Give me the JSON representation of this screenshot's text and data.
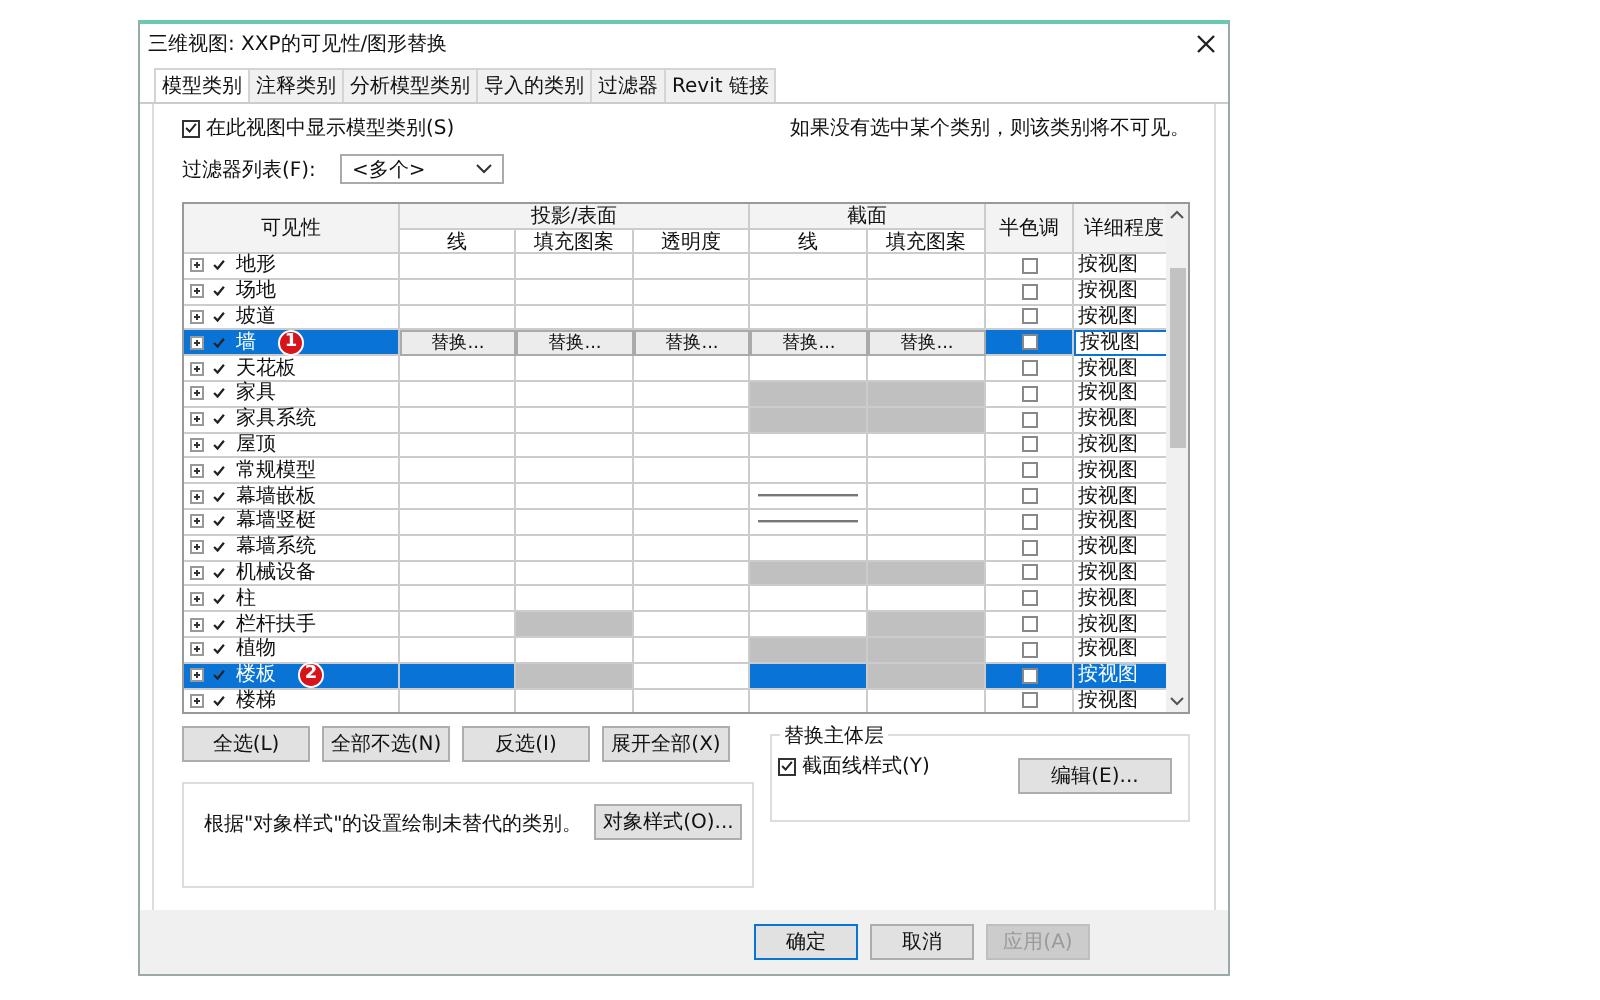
{
  "window": {
    "title": "三维视图: XXP的可见性/图形替换"
  },
  "tabs": [
    {
      "label": "模型类别",
      "selected": true
    },
    {
      "label": "注释类别",
      "selected": false
    },
    {
      "label": "分析模型类别",
      "selected": false
    },
    {
      "label": "导入的类别",
      "selected": false
    },
    {
      "label": "过滤器",
      "selected": false
    },
    {
      "label": "Revit 链接",
      "selected": false
    }
  ],
  "show_categories": {
    "label": "在此视图中显示模型类别(S)",
    "checked": true
  },
  "hint": "如果没有选中某个类别，则该类别将不可见。",
  "filter_list": {
    "label": "过滤器列表(F):",
    "value": "<多个>"
  },
  "table": {
    "group_headers": [
      {
        "label": "可见性"
      },
      {
        "label": "投影/表面"
      },
      {
        "label": "截面"
      },
      {
        "label": "半色调"
      },
      {
        "label": "详细程度"
      }
    ],
    "sub_headers": [
      "线",
      "填充图案",
      "透明度",
      "线",
      "填充图案"
    ],
    "rows": [
      {
        "name": "地形",
        "visible": true,
        "selected": false,
        "cells": [
          {
            "kind": "blank"
          },
          {
            "kind": "blank"
          },
          {
            "kind": "blank"
          },
          {
            "kind": "blank"
          },
          {
            "kind": "blank"
          }
        ],
        "halftone": false,
        "detail": "按视图"
      },
      {
        "name": "场地",
        "visible": true,
        "selected": false,
        "cells": [
          {
            "kind": "blank"
          },
          {
            "kind": "blank"
          },
          {
            "kind": "blank"
          },
          {
            "kind": "blank"
          },
          {
            "kind": "blank"
          }
        ],
        "halftone": false,
        "detail": "按视图"
      },
      {
        "name": "坡道",
        "visible": true,
        "selected": false,
        "cells": [
          {
            "kind": "blank"
          },
          {
            "kind": "blank"
          },
          {
            "kind": "blank"
          },
          {
            "kind": "blank"
          },
          {
            "kind": "blank"
          }
        ],
        "halftone": false,
        "detail": "按视图"
      },
      {
        "name": "墙",
        "visible": true,
        "selected": true,
        "badge": "1",
        "cells": [
          {
            "kind": "override",
            "label": "替换..."
          },
          {
            "kind": "override",
            "label": "替换..."
          },
          {
            "kind": "override",
            "label": "替换..."
          },
          {
            "kind": "override",
            "label": "替换..."
          },
          {
            "kind": "override",
            "label": "替换..."
          }
        ],
        "halftone": false,
        "detail": "按视图",
        "detail_editing": true
      },
      {
        "name": "天花板",
        "visible": true,
        "selected": false,
        "cells": [
          {
            "kind": "blank"
          },
          {
            "kind": "blank"
          },
          {
            "kind": "blank"
          },
          {
            "kind": "blank"
          },
          {
            "kind": "blank"
          }
        ],
        "halftone": false,
        "detail": "按视图"
      },
      {
        "name": "家具",
        "visible": true,
        "selected": false,
        "cells": [
          {
            "kind": "blank"
          },
          {
            "kind": "blank"
          },
          {
            "kind": "blank"
          },
          {
            "kind": "gray"
          },
          {
            "kind": "gray"
          }
        ],
        "halftone": false,
        "detail": "按视图"
      },
      {
        "name": "家具系统",
        "visible": true,
        "selected": false,
        "cells": [
          {
            "kind": "blank"
          },
          {
            "kind": "blank"
          },
          {
            "kind": "blank"
          },
          {
            "kind": "gray"
          },
          {
            "kind": "gray"
          }
        ],
        "halftone": false,
        "detail": "按视图"
      },
      {
        "name": "屋顶",
        "visible": true,
        "selected": false,
        "cells": [
          {
            "kind": "blank"
          },
          {
            "kind": "blank"
          },
          {
            "kind": "blank"
          },
          {
            "kind": "blank"
          },
          {
            "kind": "blank"
          }
        ],
        "halftone": false,
        "detail": "按视图"
      },
      {
        "name": "常规模型",
        "visible": true,
        "selected": false,
        "cells": [
          {
            "kind": "blank"
          },
          {
            "kind": "blank"
          },
          {
            "kind": "blank"
          },
          {
            "kind": "blank"
          },
          {
            "kind": "blank"
          }
        ],
        "halftone": false,
        "detail": "按视图"
      },
      {
        "name": "幕墙嵌板",
        "visible": true,
        "selected": false,
        "cells": [
          {
            "kind": "blank"
          },
          {
            "kind": "blank"
          },
          {
            "kind": "blank"
          },
          {
            "kind": "line"
          },
          {
            "kind": "blank"
          }
        ],
        "halftone": false,
        "detail": "按视图"
      },
      {
        "name": "幕墙竖梃",
        "visible": true,
        "selected": false,
        "cells": [
          {
            "kind": "blank"
          },
          {
            "kind": "blank"
          },
          {
            "kind": "blank"
          },
          {
            "kind": "line"
          },
          {
            "kind": "blank"
          }
        ],
        "halftone": false,
        "detail": "按视图"
      },
      {
        "name": "幕墙系统",
        "visible": true,
        "selected": false,
        "cells": [
          {
            "kind": "blank"
          },
          {
            "kind": "blank"
          },
          {
            "kind": "blank"
          },
          {
            "kind": "blank"
          },
          {
            "kind": "blank"
          }
        ],
        "halftone": false,
        "detail": "按视图"
      },
      {
        "name": "机械设备",
        "visible": true,
        "selected": false,
        "cells": [
          {
            "kind": "blank"
          },
          {
            "kind": "blank"
          },
          {
            "kind": "blank"
          },
          {
            "kind": "gray"
          },
          {
            "kind": "gray"
          }
        ],
        "halftone": false,
        "detail": "按视图"
      },
      {
        "name": "柱",
        "visible": true,
        "selected": false,
        "cells": [
          {
            "kind": "blank"
          },
          {
            "kind": "blank"
          },
          {
            "kind": "blank"
          },
          {
            "kind": "blank"
          },
          {
            "kind": "blank"
          }
        ],
        "halftone": false,
        "detail": "按视图"
      },
      {
        "name": "栏杆扶手",
        "visible": true,
        "selected": false,
        "cells": [
          {
            "kind": "blank"
          },
          {
            "kind": "gray"
          },
          {
            "kind": "blank"
          },
          {
            "kind": "blank"
          },
          {
            "kind": "gray"
          }
        ],
        "halftone": false,
        "detail": "按视图"
      },
      {
        "name": "植物",
        "visible": true,
        "selected": false,
        "cells": [
          {
            "kind": "blank"
          },
          {
            "kind": "blank"
          },
          {
            "kind": "blank"
          },
          {
            "kind": "gray"
          },
          {
            "kind": "gray"
          }
        ],
        "halftone": false,
        "detail": "按视图"
      },
      {
        "name": "楼板",
        "visible": true,
        "selected": true,
        "badge": "2",
        "cells": [
          {
            "kind": "blank"
          },
          {
            "kind": "gray"
          },
          {
            "kind": "white"
          },
          {
            "kind": "blank"
          },
          {
            "kind": "gray"
          }
        ],
        "halftone": false,
        "detail": "按视图"
      },
      {
        "name": "楼梯",
        "visible": true,
        "selected": false,
        "cells": [
          {
            "kind": "blank"
          },
          {
            "kind": "blank"
          },
          {
            "kind": "blank"
          },
          {
            "kind": "blank"
          },
          {
            "kind": "blank"
          }
        ],
        "halftone": false,
        "detail": "按视图"
      }
    ]
  },
  "table_buttons": [
    "全选(L)",
    "全部不选(N)",
    "反选(I)",
    "展开全部(X)"
  ],
  "object_styles": {
    "text": "根据\"对象样式\"的设置绘制未替代的类别。",
    "button": "对象样式(O)..."
  },
  "host_layers": {
    "title": "替换主体层",
    "checkbox": {
      "label": "截面线样式(Y)",
      "checked": true
    },
    "button": "编辑(E)..."
  },
  "footer_buttons": [
    {
      "label": "确定",
      "kind": "default"
    },
    {
      "label": "取消",
      "kind": "normal"
    },
    {
      "label": "应用(A)",
      "kind": "disabled"
    }
  ]
}
